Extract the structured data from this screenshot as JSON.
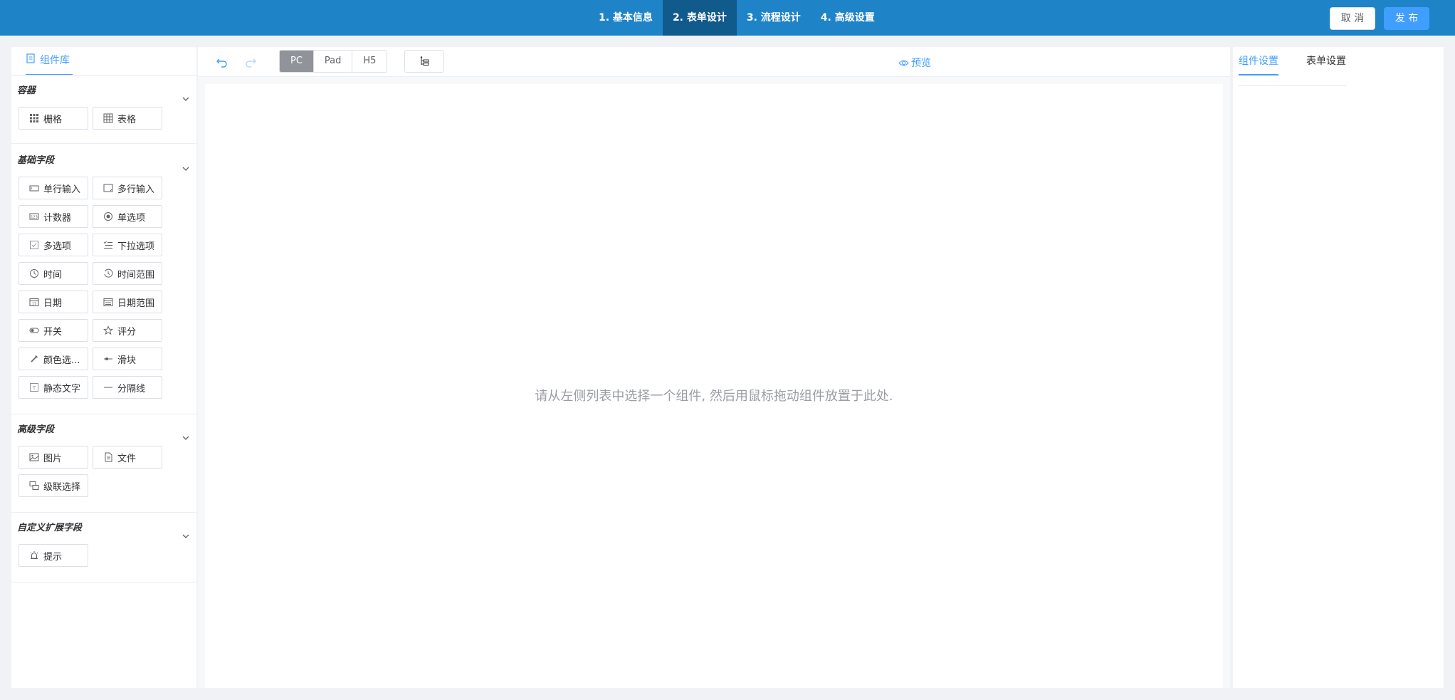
{
  "header": {
    "steps": [
      "1. 基本信息",
      "2. 表单设计",
      "3. 流程设计",
      "4. 高级设置"
    ],
    "active_step": 1,
    "cancel_label": "取 消",
    "publish_label": "发 布"
  },
  "left_panel": {
    "tab_label": "组件库",
    "groups": [
      {
        "title": "容器",
        "items": [
          {
            "label": "栅格",
            "icon": "grid-icon"
          },
          {
            "label": "表格",
            "icon": "table-icon"
          }
        ]
      },
      {
        "title": "基础字段",
        "items": [
          {
            "label": "单行输入",
            "icon": "input-icon"
          },
          {
            "label": "多行输入",
            "icon": "textarea-icon"
          },
          {
            "label": "计数器",
            "icon": "counter-icon"
          },
          {
            "label": "单选项",
            "icon": "radio-icon"
          },
          {
            "label": "多选项",
            "icon": "checkbox-icon"
          },
          {
            "label": "下拉选项",
            "icon": "select-icon"
          },
          {
            "label": "时间",
            "icon": "clock-icon"
          },
          {
            "label": "时间范围",
            "icon": "time-range-icon"
          },
          {
            "label": "日期",
            "icon": "date-icon"
          },
          {
            "label": "日期范围",
            "icon": "date-range-icon"
          },
          {
            "label": "开关",
            "icon": "switch-icon"
          },
          {
            "label": "评分",
            "icon": "star-icon"
          },
          {
            "label": "颜色选...",
            "icon": "color-picker-icon"
          },
          {
            "label": "滑块",
            "icon": "slider-icon"
          },
          {
            "label": "静态文字",
            "icon": "static-text-icon"
          },
          {
            "label": "分隔线",
            "icon": "divider-icon"
          }
        ]
      },
      {
        "title": "高级字段",
        "items": [
          {
            "label": "图片",
            "icon": "image-icon"
          },
          {
            "label": "文件",
            "icon": "file-icon"
          },
          {
            "label": "级联选择",
            "icon": "cascader-icon"
          }
        ]
      },
      {
        "title": "自定义扩展字段",
        "items": [
          {
            "label": "提示",
            "icon": "alert-icon"
          }
        ]
      }
    ]
  },
  "toolbar": {
    "undo_icon": "undo-icon",
    "redo_icon": "redo-icon",
    "devices": [
      "PC",
      "Pad",
      "H5"
    ],
    "active_device": 0,
    "tree_icon": "tree-icon",
    "preview_label": "预览"
  },
  "canvas": {
    "empty_hint": "请从左侧列表中选择一个组件, 然后用鼠标拖动组件放置于此处."
  },
  "right_panel": {
    "tabs": [
      "组件设置",
      "表单设置"
    ],
    "active_tab": 0
  },
  "colors": {
    "header_bg": "#1f83c8",
    "header_active": "#115a8c",
    "accent": "#409eff"
  }
}
